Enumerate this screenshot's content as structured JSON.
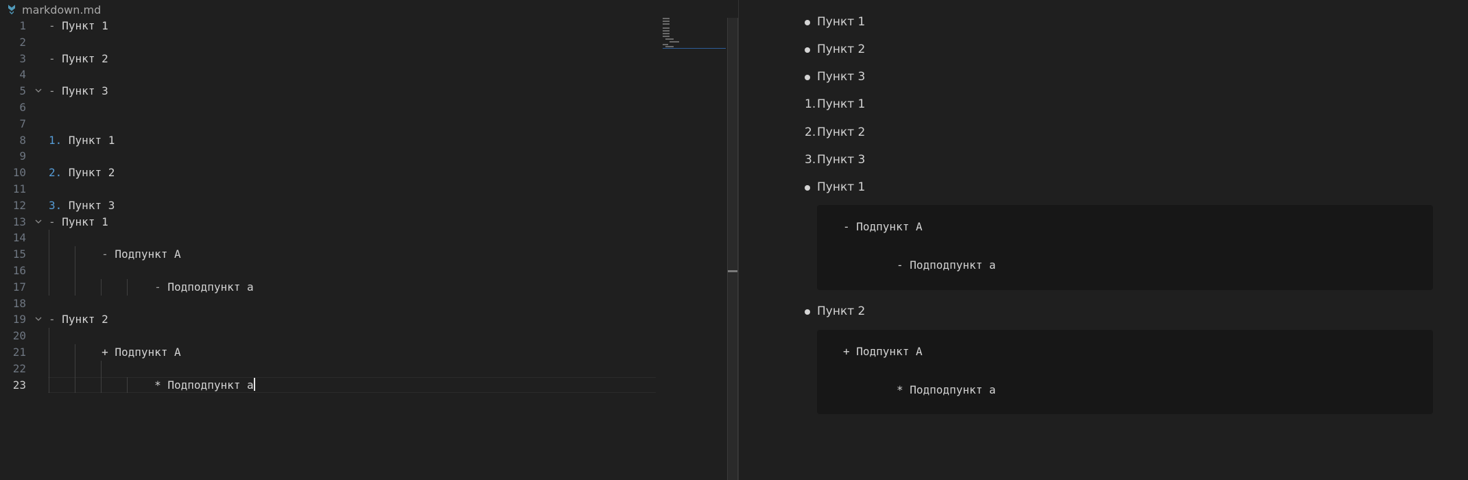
{
  "breadcrumb": {
    "filename": "markdown.md",
    "icon": "markdown-file-icon",
    "icon_color": "#519aba"
  },
  "editor": {
    "lines": [
      {
        "n": "1",
        "parts": [
          {
            "k": "mk",
            "t": "- "
          },
          {
            "k": "tx",
            "t": "Пункт 1"
          }
        ]
      },
      {
        "n": "2",
        "parts": []
      },
      {
        "n": "3",
        "parts": [
          {
            "k": "mk",
            "t": "- "
          },
          {
            "k": "tx",
            "t": "Пункт 2"
          }
        ]
      },
      {
        "n": "4",
        "parts": []
      },
      {
        "n": "5",
        "fold": true,
        "parts": [
          {
            "k": "mk",
            "t": "- "
          },
          {
            "k": "tx",
            "t": "Пункт 3"
          }
        ]
      },
      {
        "n": "6",
        "parts": []
      },
      {
        "n": "7",
        "parts": []
      },
      {
        "n": "8",
        "parts": [
          {
            "k": "num",
            "t": "1. "
          },
          {
            "k": "tx",
            "t": "Пункт 1"
          }
        ]
      },
      {
        "n": "9",
        "parts": []
      },
      {
        "n": "10",
        "parts": [
          {
            "k": "num",
            "t": "2. "
          },
          {
            "k": "tx",
            "t": "Пункт 2"
          }
        ]
      },
      {
        "n": "11",
        "parts": []
      },
      {
        "n": "12",
        "parts": [
          {
            "k": "num",
            "t": "3. "
          },
          {
            "k": "tx",
            "t": "Пункт 3"
          }
        ]
      },
      {
        "n": "13",
        "fold": true,
        "parts": [
          {
            "k": "mk",
            "t": "- "
          },
          {
            "k": "tx",
            "t": "Пункт 1"
          }
        ]
      },
      {
        "n": "14",
        "guides": 1,
        "parts": []
      },
      {
        "n": "15",
        "guides": 2,
        "parts": [
          {
            "k": "tx",
            "t": "        "
          },
          {
            "k": "mk",
            "t": "- "
          },
          {
            "k": "tx",
            "t": "Подпункт A"
          }
        ]
      },
      {
        "n": "16",
        "guides": 2,
        "parts": []
      },
      {
        "n": "17",
        "guides": 4,
        "parts": [
          {
            "k": "tx",
            "t": "                "
          },
          {
            "k": "mk",
            "t": "- "
          },
          {
            "k": "tx",
            "t": "Подподпункт a"
          }
        ]
      },
      {
        "n": "18",
        "parts": []
      },
      {
        "n": "19",
        "fold": true,
        "parts": [
          {
            "k": "mk",
            "t": "- "
          },
          {
            "k": "tx",
            "t": "Пункт 2"
          }
        ]
      },
      {
        "n": "20",
        "guides": 1,
        "parts": []
      },
      {
        "n": "21",
        "guides": 2,
        "parts": [
          {
            "k": "tx",
            "t": "        + Подпункт A"
          }
        ]
      },
      {
        "n": "22",
        "guides": 3,
        "parts": []
      },
      {
        "n": "23",
        "guides": 4,
        "current": true,
        "parts": [
          {
            "k": "tx",
            "t": "                * Подподпункт a"
          }
        ]
      }
    ]
  },
  "preview": {
    "bullets_top": [
      "Пункт 1",
      "Пункт 2",
      "Пункт 3"
    ],
    "numbered": [
      {
        "n": "1.",
        "t": "Пункт 1"
      },
      {
        "n": "2.",
        "t": "Пункт 2"
      },
      {
        "n": "3.",
        "t": "Пункт 3"
      }
    ],
    "item_a": "Пункт 1",
    "code_a": [
      "- Подпункт A",
      "- Подподпункт a"
    ],
    "item_b": "Пункт 2",
    "code_b": [
      "+ Подпункт A",
      "* Подподпункт a"
    ]
  }
}
